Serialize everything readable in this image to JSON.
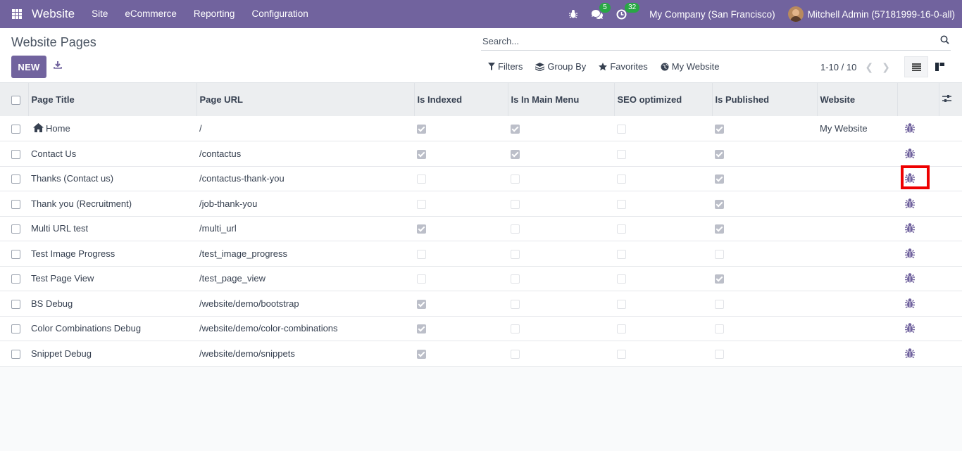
{
  "navbar": {
    "brand": "Website",
    "menu": [
      "Site",
      "eCommerce",
      "Reporting",
      "Configuration"
    ],
    "messages_count": "5",
    "activities_count": "32",
    "company": "My Company (San Francisco)",
    "user": "Mitchell Admin (57181999-16-0-all)"
  },
  "control_panel": {
    "title": "Website Pages",
    "new_label": "NEW",
    "search_placeholder": "Search...",
    "filters_label": "Filters",
    "group_by_label": "Group By",
    "favorites_label": "Favorites",
    "website_label": "My Website",
    "pager": "1-10 / 10"
  },
  "table": {
    "columns": [
      "Page Title",
      "Page URL",
      "Is Indexed",
      "Is In Main Menu",
      "SEO optimized",
      "Is Published",
      "Website"
    ],
    "rows": [
      {
        "title": "Home",
        "url": "/",
        "indexed": true,
        "main_menu": true,
        "seo": false,
        "published": true,
        "website": "My Website",
        "home_icon": true
      },
      {
        "title": "Contact Us",
        "url": "/contactus",
        "indexed": true,
        "main_menu": true,
        "seo": false,
        "published": true,
        "website": ""
      },
      {
        "title": "Thanks (Contact us)",
        "url": "/contactus-thank-you",
        "indexed": false,
        "main_menu": false,
        "seo": false,
        "published": true,
        "website": ""
      },
      {
        "title": "Thank you (Recruitment)",
        "url": "/job-thank-you",
        "indexed": false,
        "main_menu": false,
        "seo": false,
        "published": true,
        "website": ""
      },
      {
        "title": "Multi URL test",
        "url": "/multi_url",
        "indexed": true,
        "main_menu": false,
        "seo": false,
        "published": true,
        "website": ""
      },
      {
        "title": "Test Image Progress",
        "url": "/test_image_progress",
        "indexed": false,
        "main_menu": false,
        "seo": false,
        "published": false,
        "website": ""
      },
      {
        "title": "Test Page View",
        "url": "/test_page_view",
        "indexed": false,
        "main_menu": false,
        "seo": false,
        "published": true,
        "website": ""
      },
      {
        "title": "BS Debug",
        "url": "/website/demo/bootstrap",
        "indexed": true,
        "main_menu": false,
        "seo": false,
        "published": false,
        "website": ""
      },
      {
        "title": "Color Combinations Debug",
        "url": "/website/demo/color-combinations",
        "indexed": true,
        "main_menu": false,
        "seo": false,
        "published": false,
        "website": ""
      },
      {
        "title": "Snippet Debug",
        "url": "/website/demo/snippets",
        "indexed": true,
        "main_menu": false,
        "seo": false,
        "published": false,
        "website": ""
      }
    ]
  },
  "colors": {
    "brand": "#71639e",
    "badge": "#28a745",
    "highlight": "#ee0000"
  },
  "icons": [
    "apps-grid-icon",
    "bug-icon",
    "chat-icon",
    "clock-icon",
    "download-icon",
    "search-icon",
    "filter-icon",
    "layers-icon",
    "star-icon",
    "globe-icon",
    "chevron-left-icon",
    "chevron-right-icon",
    "list-view-icon",
    "kanban-view-icon",
    "settings-sliders-icon",
    "home-icon"
  ]
}
